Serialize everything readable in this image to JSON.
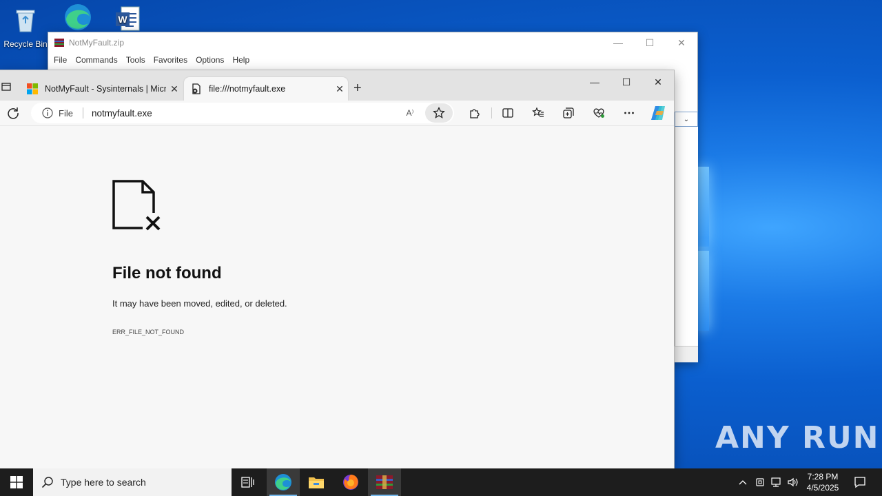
{
  "desktop": {
    "icons": [
      {
        "label": "Recycle Bin"
      },
      {
        "label": ""
      },
      {
        "label": ""
      }
    ],
    "watermark": "ANY RUN"
  },
  "winrar": {
    "title": "NotMyFault.zip",
    "menu": [
      "File",
      "Commands",
      "Tools",
      "Favorites",
      "Options",
      "Help"
    ],
    "controls": {
      "minimize": "—",
      "maximize": "☐",
      "close": "✕"
    }
  },
  "edge": {
    "tabs": [
      {
        "title": "NotMyFault - Sysinternals | Micro",
        "close": "✕"
      },
      {
        "title": "file:///notmyfault.exe",
        "close": "✕"
      }
    ],
    "new_tab": "+",
    "controls": {
      "minimize": "—",
      "maximize": "☐",
      "close": "✕"
    },
    "address": {
      "site_label": "File",
      "url": "notmyfault.exe",
      "read_aloud": "A⁾"
    },
    "error": {
      "title": "File not found",
      "description": "It may have been moved, edited, or deleted.",
      "code": "ERR_FILE_NOT_FOUND"
    }
  },
  "taskbar": {
    "search_placeholder": "Type here to search",
    "clock_time": "7:28 PM",
    "clock_date": "4/5/2025"
  },
  "colors": {
    "taskbar_bg": "#1d1d1d",
    "accent": "#0078d4",
    "edge_content_bg": "#f7f7f7"
  }
}
